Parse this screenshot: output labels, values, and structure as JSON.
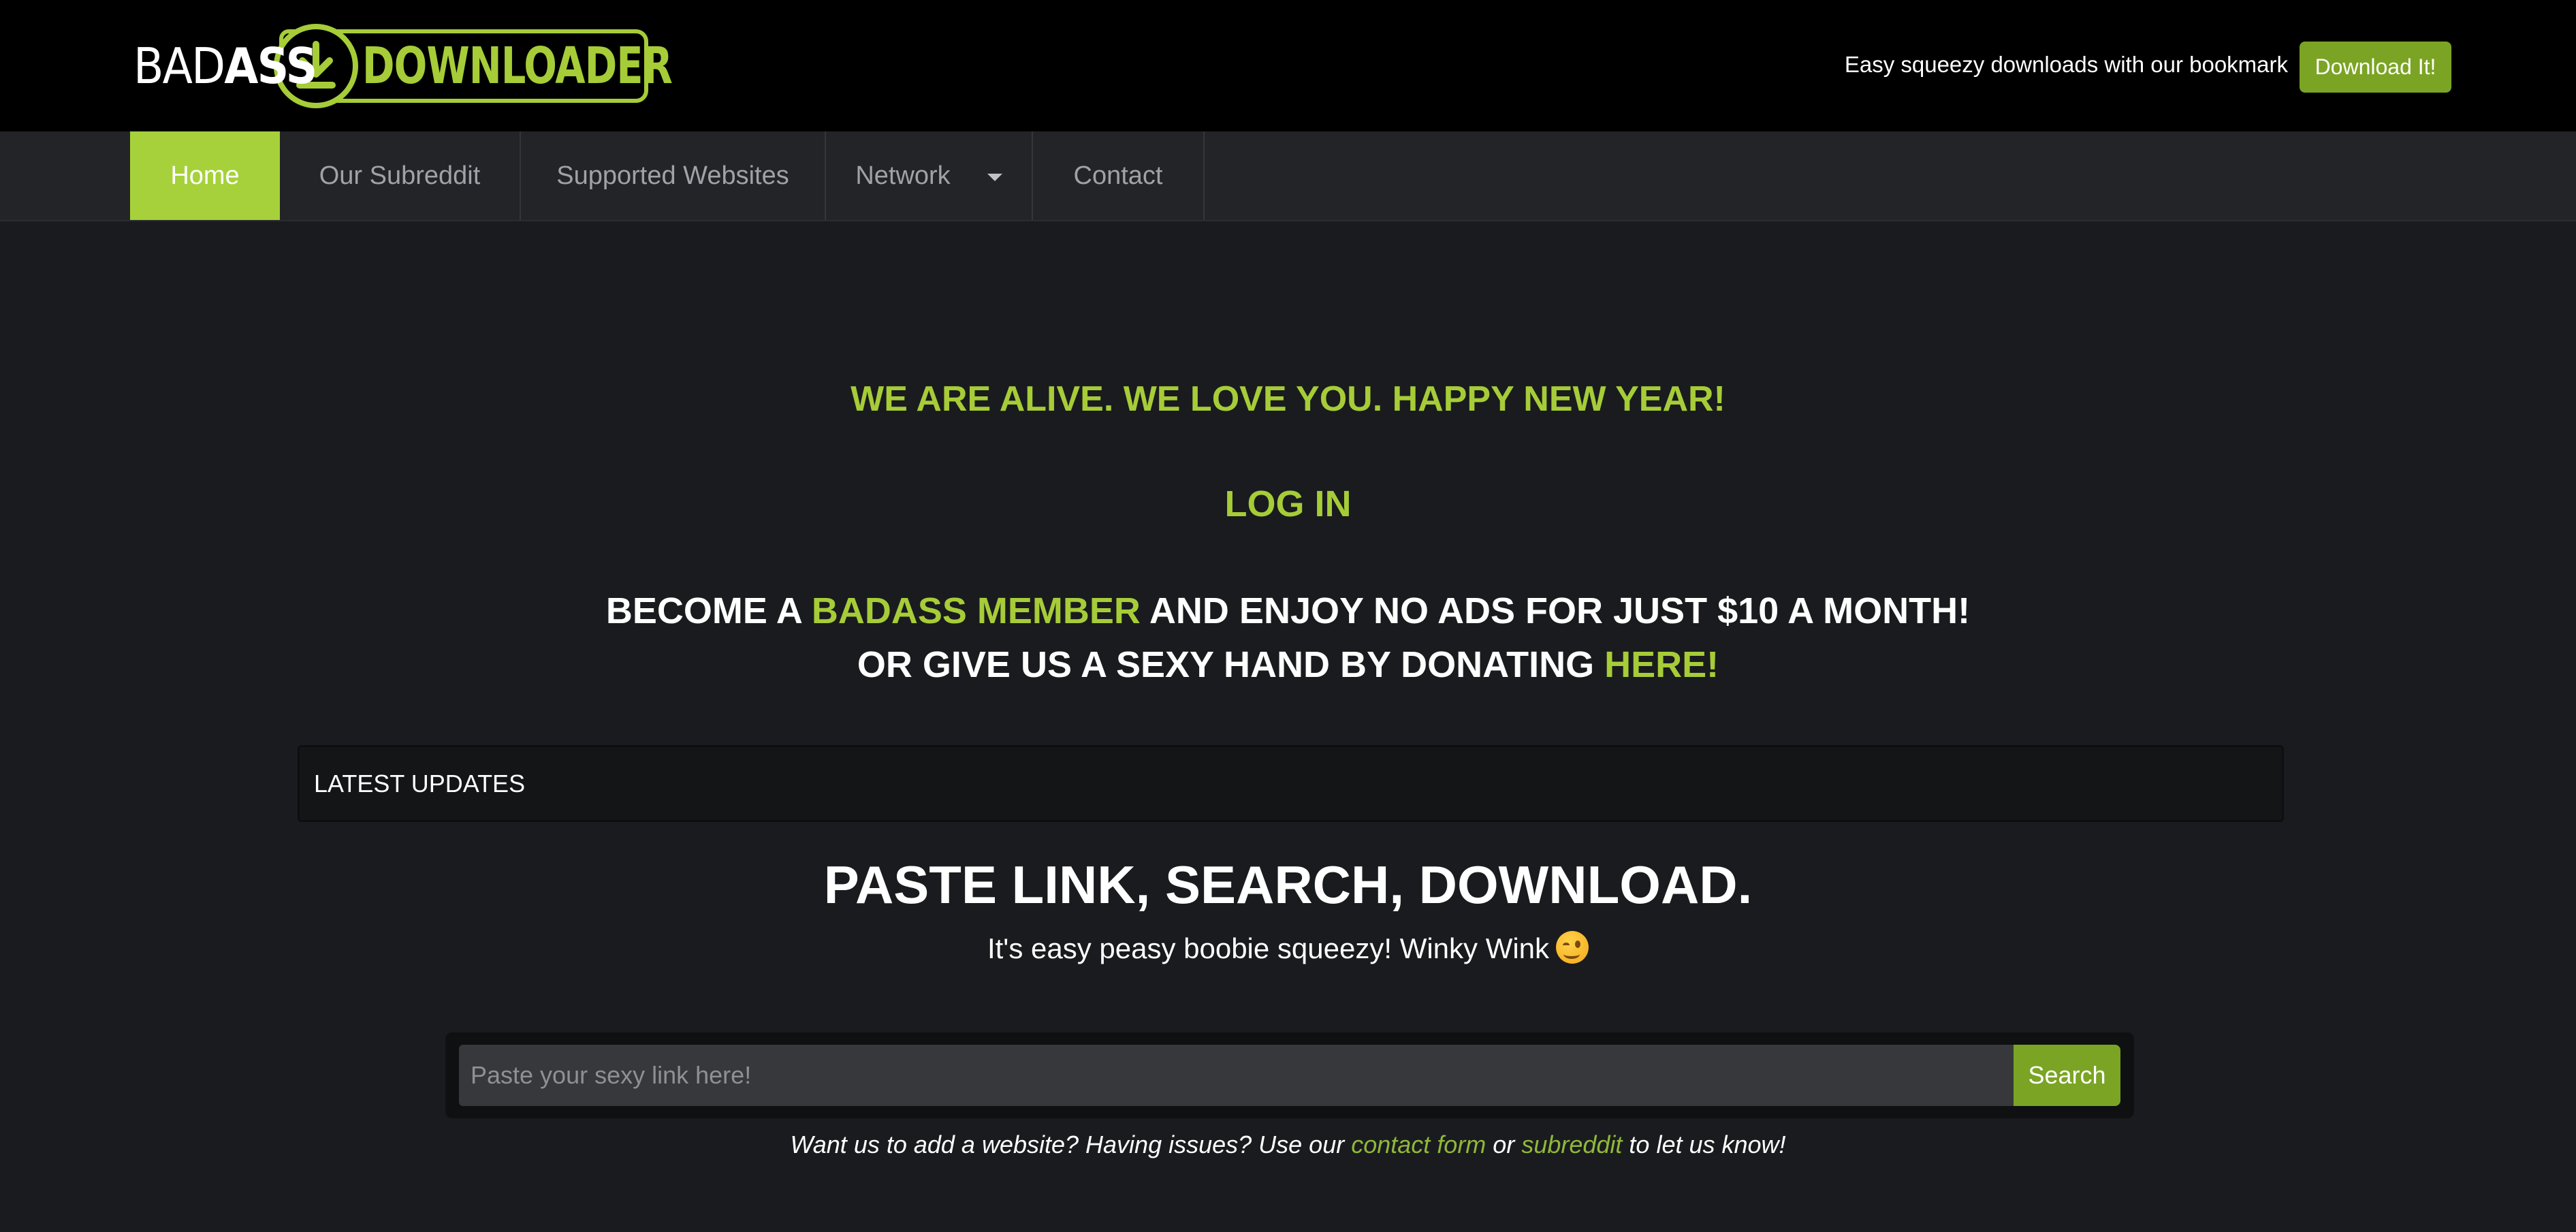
{
  "header": {
    "logo_left": "BAD",
    "logo_left_bold": "ASS",
    "logo_right": "DOWNLOADER",
    "tagline": "Easy squeezy downloads with our bookmark",
    "download_button": "Download It!"
  },
  "nav": {
    "items": [
      {
        "label": "Home"
      },
      {
        "label": "Our Subreddit"
      },
      {
        "label": "Supported Websites"
      },
      {
        "label": "Network"
      },
      {
        "label": "Contact"
      }
    ]
  },
  "main": {
    "announcement": "WE ARE ALIVE. WE LOVE YOU. HAPPY NEW YEAR!",
    "login": "LOG IN",
    "member_line": {
      "prefix": "BECOME A ",
      "link": "BADASS MEMBER",
      "suffix": " AND ENJOY NO ADS FOR JUST $10 A MONTH!"
    },
    "donate_line": {
      "prefix": "OR GIVE US A SEXY HAND BY DONATING ",
      "link": "HERE!"
    },
    "latest_updates": "LATEST UPDATES",
    "title": "PASTE LINK, SEARCH, DOWNLOAD.",
    "subtitle": "It's easy peasy boobie squeezy! Winky Wink",
    "search": {
      "placeholder": "Paste your sexy link here!",
      "value": "",
      "button": "Search"
    },
    "help": {
      "before": "Want us to add a website? Having issues? Use our ",
      "link1": "contact form",
      "middle": " or ",
      "link2": "subreddit",
      "after": " to let us know!"
    }
  },
  "colors": {
    "accent": "#a6cc38",
    "button": "#7ba424",
    "background": "#1a1b1e",
    "header": "#000000"
  },
  "icons": [
    "download-arrow-icon",
    "caret-down-icon",
    "wink-emoji-icon"
  ]
}
